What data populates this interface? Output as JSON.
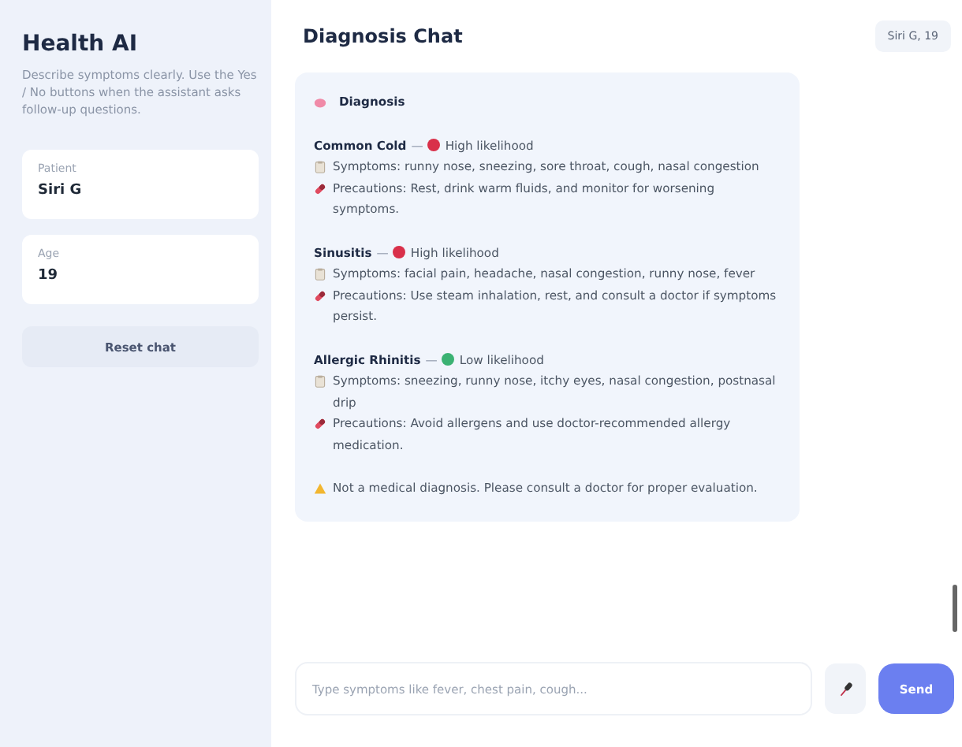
{
  "sidebar": {
    "title": "Health AI",
    "description": "Describe symptoms clearly. Use the Yes / No buttons when the assistant asks follow-up questions.",
    "fields": [
      {
        "label": "Patient",
        "value": "Siri G"
      },
      {
        "label": "Age",
        "value": "19"
      }
    ],
    "reset_button": "Reset chat"
  },
  "header": {
    "title": "Diagnosis Chat",
    "badge": "Siri G, 19"
  },
  "message": {
    "heading": "Diagnosis",
    "separator": "—",
    "conditions": [
      {
        "name": "Common Cold",
        "likelihood": "High likelihood",
        "color": "#d9304a",
        "symptoms": "Symptoms: runny nose, sneezing, sore throat, cough, nasal congestion",
        "precautions": "Precautions: Rest, drink warm fluids, and monitor for worsening symptoms."
      },
      {
        "name": "Sinusitis",
        "likelihood": "High likelihood",
        "color": "#d9304a",
        "symptoms": "Symptoms: facial pain, headache, nasal congestion, runny nose, fever",
        "precautions": "Precautions: Use steam inhalation, rest, and consult a doctor if symptoms persist."
      },
      {
        "name": "Allergic Rhinitis",
        "likelihood": "Low likelihood",
        "color": "#3bb273",
        "symptoms": "Symptoms: sneezing, runny nose, itchy eyes, nasal congestion, postnasal drip",
        "precautions": "Precautions: Avoid allergens and use doctor-recommended allergy medication."
      }
    ],
    "disclaimer": "Not a medical diagnosis. Please consult a doctor for proper evaluation."
  },
  "composer": {
    "placeholder": "Type symptoms like fever, chest pain, cough...",
    "send_button": "Send"
  }
}
